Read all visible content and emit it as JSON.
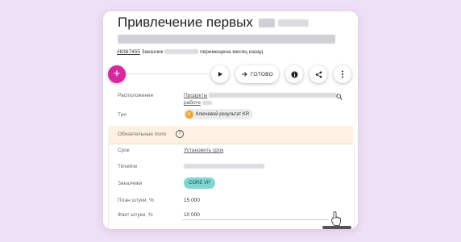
{
  "title": {
    "line1": "Привлечение первых"
  },
  "meta": {
    "id_link": "#8367455",
    "customer_label": "Заказчик",
    "moved_text": "перемещена месяц назад"
  },
  "toolbar": {
    "add_label": "+",
    "done_label": "ГОТОВО",
    "play_icon": "play-icon",
    "info_icon": "info-icon",
    "share_icon": "share-icon",
    "more_icon": "more-vertical-icon",
    "fab_color": "#d6289f"
  },
  "fields": {
    "location": {
      "label": "Расположение",
      "value_start": "Продукты",
      "value_line2_start": "работе",
      "search_icon": "search-icon"
    },
    "type": {
      "label": "Тип",
      "chip_letter": "K",
      "chip_text": "Ключевой результат KR",
      "chip_color": "#f0a531"
    },
    "required_section": {
      "label": "Обязательные поля",
      "help_icon": "help-circle-icon",
      "bg_color": "#fdf1e4"
    },
    "deadline": {
      "label": "Срок",
      "value": "Установить срок"
    },
    "timeline": {
      "label": "Timeline"
    },
    "customers": {
      "label": "Заказчики",
      "chip_text": "CORE VP",
      "chip_color": "#7fd6d2"
    },
    "plan": {
      "label": "План штуки, %",
      "value": "15 000"
    },
    "fact": {
      "label": "Факт штуки, %",
      "value": "10 000"
    }
  }
}
